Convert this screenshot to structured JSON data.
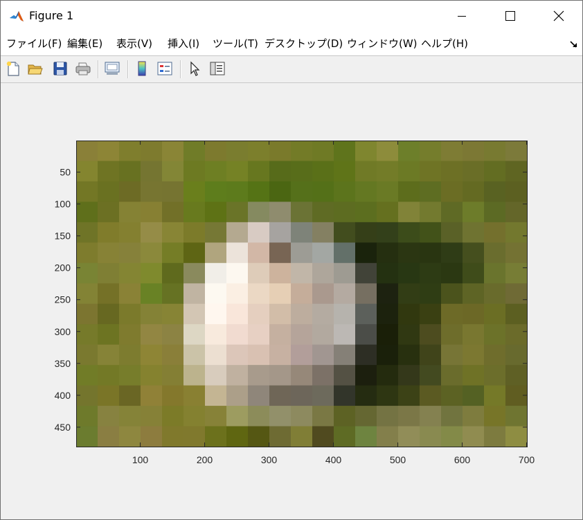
{
  "window": {
    "title": "Figure 1"
  },
  "menu": [
    {
      "label": "ファイル(F)"
    },
    {
      "label": "編集(E)"
    },
    {
      "label": "表示(V)"
    },
    {
      "label": "挿入(I)"
    },
    {
      "label": "ツール(T)"
    },
    {
      "label": "デスクトップ(D)"
    },
    {
      "label": "ウィンドウ(W)"
    },
    {
      "label": "ヘルプ(H)"
    }
  ],
  "chart_data": {
    "type": "heatmap",
    "title": "",
    "xlabel": "",
    "ylabel": "",
    "xlim": [
      1,
      700
    ],
    "ylim": [
      1,
      480
    ],
    "x_ticks": [
      100,
      200,
      300,
      400,
      500,
      600,
      700
    ],
    "y_ticks": [
      50,
      100,
      150,
      200,
      250,
      300,
      350,
      400,
      450
    ],
    "y_direction": "reverse",
    "block_rows": 14,
    "block_cols": 21,
    "pixels": [
      [
        "#8a8038",
        "#8d8536",
        "#7f7e2d",
        "#7e7b2e",
        "#8a8536",
        "#707c28",
        "#7d7a2e",
        "#7a7d2f",
        "#7c7f2c",
        "#7a7a2b",
        "#737b27",
        "#6f7a25",
        "#5f741c",
        "#7f862f",
        "#8d8c3b",
        "#6d7f2a",
        "#757d2c",
        "#7e7c34",
        "#7c7834",
        "#787a31",
        "#7c7a3a"
      ],
      [
        "#84852f",
        "#6f7423",
        "#687121",
        "#757531",
        "#838636",
        "#6d7a22",
        "#6e7f23",
        "#758225",
        "#67771f",
        "#576b1a",
        "#586d1a",
        "#5a7018",
        "#5f7418",
        "#707a26",
        "#737c28",
        "#6c7a25",
        "#6f7425",
        "#6d7025",
        "#6a6e27",
        "#636d22",
        "#5f6522"
      ],
      [
        "#737725",
        "#6a7121",
        "#6d6b25",
        "#777531",
        "#767431",
        "#6a7f1c",
        "#5e7d1c",
        "#5d7b1c",
        "#557315",
        "#4b6612",
        "#55701a",
        "#547018",
        "#5c741c",
        "#647822",
        "#6a7a25",
        "#5d6d1c",
        "#5e6d22",
        "#6b6d24",
        "#646a22",
        "#596222",
        "#5c6021"
      ],
      [
        "#5f6f1b",
        "#6c7023",
        "#858234",
        "#878033",
        "#727028",
        "#687a1e",
        "#5e7215",
        "#6a7428",
        "#858a60",
        "#8f8c6e",
        "#6b7335",
        "#5f6b24",
        "#5d6c21",
        "#5c6e1f",
        "#65701f",
        "#818338",
        "#737a2f",
        "#5f6a25",
        "#6d7c2a",
        "#5c6a24",
        "#646629"
      ],
      [
        "#6f7427",
        "#807c2b",
        "#848030",
        "#958c47",
        "#888535",
        "#7c7b2a",
        "#767835",
        "#b4a990",
        "#d8cbc3",
        "#a6a3a0",
        "#7e8379",
        "#848062",
        "#424d1e",
        "#353f18",
        "#33401a",
        "#3c4c1a",
        "#425219",
        "#5a6127",
        "#6f7331",
        "#74702d",
        "#73782e"
      ],
      [
        "#7e7c2d",
        "#878236",
        "#86813a",
        "#8b893b",
        "#757d26",
        "#5e6514",
        "#b0a57e",
        "#ece3da",
        "#d2b7a6",
        "#786554",
        "#9d9c95",
        "#a3a7a3",
        "#637069",
        "#1a230c",
        "#252f10",
        "#2b3612",
        "#293511",
        "#2f3c16",
        "#454f1e",
        "#6a6d2e",
        "#747233"
      ],
      [
        "#798434",
        "#7f7f34",
        "#848533",
        "#7f8a2d",
        "#5f6a1d",
        "#8a8a5d",
        "#f1eee8",
        "#fdf8f0",
        "#deccb9",
        "#cdb39d",
        "#c1b6a8",
        "#aea69b",
        "#9e9b92",
        "#414338",
        "#243111",
        "#283713",
        "#2d3b14",
        "#2b3812",
        "#3f4c1a",
        "#6a742d",
        "#777d35"
      ],
      [
        "#838335",
        "#757127",
        "#8a8236",
        "#698225",
        "#667223",
        "#c0b4a2",
        "#fdf9f1",
        "#fbefe3",
        "#ebd8c4",
        "#e6cfb5",
        "#c5ad9a",
        "#aa998e",
        "#b4aaa1",
        "#766f61",
        "#1d2210",
        "#323d15",
        "#2f3d14",
        "#4b531c",
        "#5e6425",
        "#696b2c",
        "#6f6a35"
      ],
      [
        "#7c7530",
        "#676821",
        "#7b7a2b",
        "#848236",
        "#878435",
        "#d3c6b4",
        "#fff7ef",
        "#f9e6da",
        "#e5cfbf",
        "#d2bda8",
        "#bdad9e",
        "#b4aba1",
        "#b6b3ad",
        "#5c605b",
        "#1c220d",
        "#31380f",
        "#3a4012",
        "#6d6a27",
        "#6c6826",
        "#6b6e24",
        "#5c5f21"
      ],
      [
        "#767a2a",
        "#6d7422",
        "#7f7b2e",
        "#928642",
        "#8c8343",
        "#ddd7c4",
        "#f8eadd",
        "#f1dbd0",
        "#e7d0c3",
        "#c5b0a0",
        "#b5a49a",
        "#b2a99f",
        "#bcb8b4",
        "#4b4d48",
        "#1a1f08",
        "#303812",
        "#4d4c1f",
        "#6e6d2b",
        "#797730",
        "#6c7229",
        "#6b6b2a"
      ],
      [
        "#7a792f",
        "#868337",
        "#7d7c2f",
        "#8e8535",
        "#8a7f39",
        "#cbc3a8",
        "#ecdfd1",
        "#dcc6b9",
        "#d9c1b2",
        "#c7b1a2",
        "#b29e9a",
        "#a19691",
        "#858077",
        "#2d2e24",
        "#1a200a",
        "#28300f",
        "#40441a",
        "#777536",
        "#7c7831",
        "#6f6d2c",
        "#686a2e"
      ],
      [
        "#717c27",
        "#737926",
        "#777d2b",
        "#85822f",
        "#847f34",
        "#bcb38d",
        "#d8ccbd",
        "#c0b1a0",
        "#a89b8c",
        "#a49789",
        "#968879",
        "#7c7167",
        "#545144",
        "#1c1f0e",
        "#242b0e",
        "#34381a",
        "#434a20",
        "#6a6c2c",
        "#6f7226",
        "#6c6e2b",
        "#5f6025"
      ],
      [
        "#74752d",
        "#7a7527",
        "#6a6624",
        "#908137",
        "#84782c",
        "#898032",
        "#c4b593",
        "#ac9f89",
        "#8f867a",
        "#6f6657",
        "#6d665a",
        "#6d6a5c",
        "#32352a",
        "#252c11",
        "#2e3612",
        "#3c4216",
        "#5b5a22",
        "#5c6223",
        "#546123",
        "#757928",
        "#605d21"
      ],
      [
        "#6e7a2b",
        "#878240",
        "#858338",
        "#868137",
        "#7c7b28",
        "#848130",
        "#878238",
        "#9d9c60",
        "#8c8c5a",
        "#92906a",
        "#8d8a5f",
        "#7a7844",
        "#5d6224",
        "#656732",
        "#747343",
        "#7b7747",
        "#848150",
        "#71743f",
        "#7e7c3e",
        "#777528",
        "#6f7531"
      ],
      [
        "#6b7c2f",
        "#8a7e42",
        "#8e873f",
        "#8d7c3e",
        "#80792c",
        "#80792d",
        "#6c711c",
        "#5f6611",
        "#555713",
        "#6e6b33",
        "#807e36",
        "#504a1f",
        "#5e6b24",
        "#6e8440",
        "#837f4b",
        "#918d58",
        "#898a50",
        "#838a48",
        "#908c50",
        "#7d7b3f",
        "#8e8d42"
      ]
    ]
  }
}
